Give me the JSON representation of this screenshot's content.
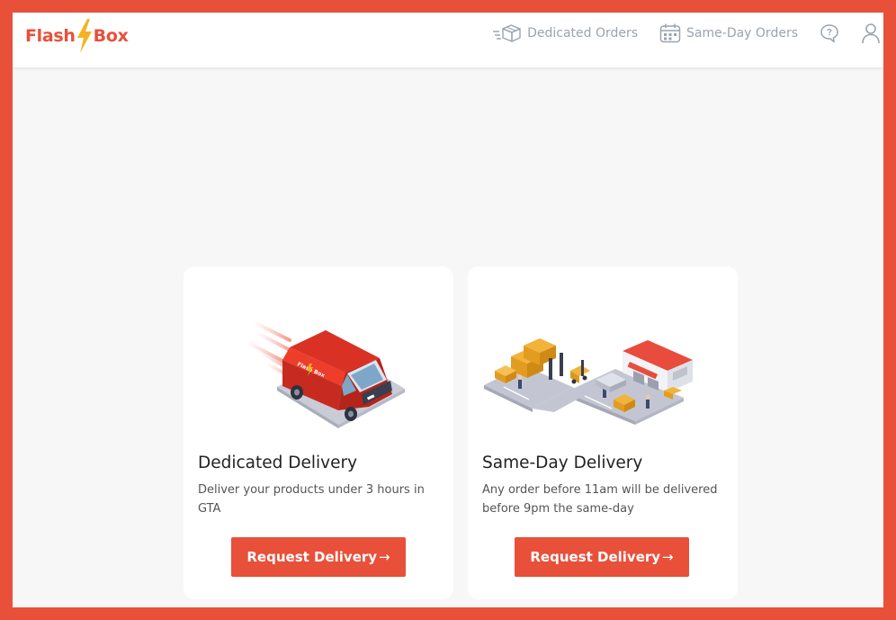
{
  "brand": {
    "name_part1": "Flash",
    "name_part2": "Box",
    "accent_color": "#e8503a",
    "bolt_color": "#f4b324"
  },
  "nav": {
    "dedicated_orders": "Dedicated Orders",
    "dedicated_orders_icon": "box-icon",
    "same_day_orders": "Same-Day Orders",
    "same_day_orders_icon": "calendar-icon",
    "chat_icon": "chat-icon",
    "user_icon": "user-icon"
  },
  "cards": [
    {
      "title": "Dedicated Delivery",
      "description": "Deliver your products under 3 hours in GTA",
      "button_label": "Request Delivery",
      "button_arrow": "→",
      "illustration": "delivery-van-illustration"
    },
    {
      "title": "Same-Day Delivery",
      "description": "Any order before 11am will be delivered before 9pm the same-day",
      "button_label": "Request Delivery",
      "button_arrow": "→",
      "illustration": "warehouse-illustration"
    }
  ]
}
